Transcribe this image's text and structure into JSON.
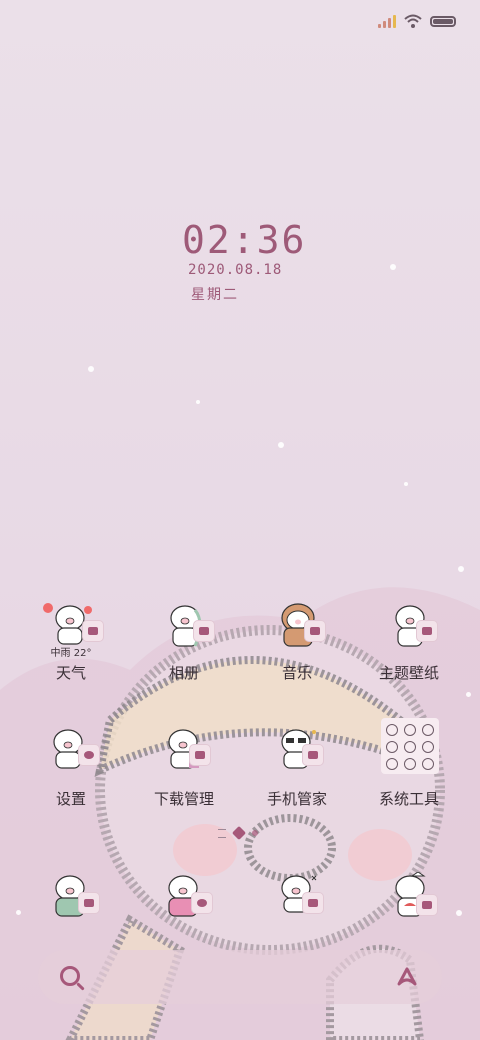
{
  "status_bar": {
    "signal_icon": "signal-icon",
    "wifi_icon": "wifi-icon",
    "battery_icon": "battery-icon"
  },
  "lockscreen": {
    "time": "02:36",
    "date": "2020.08.18",
    "weekday": "星期二"
  },
  "apps_row1": [
    {
      "label": "天气",
      "weather_text": "中雨 22°"
    },
    {
      "label": "相册"
    },
    {
      "label": "音乐"
    },
    {
      "label": "主题壁纸"
    }
  ],
  "apps_row2": [
    {
      "label": "设置"
    },
    {
      "label": "下载管理"
    },
    {
      "label": "手机管家"
    },
    {
      "label": "系统工具"
    }
  ],
  "dock": {
    "items": [
      "phone-app",
      "browser-app",
      "messages-app",
      "camera-app"
    ]
  },
  "search": {
    "search_icon": "search-icon",
    "assistant_icon": "assistant-icon"
  },
  "colors": {
    "accent": "#a6587a",
    "text": "#3a2f36",
    "background": "#ebe0e9"
  }
}
